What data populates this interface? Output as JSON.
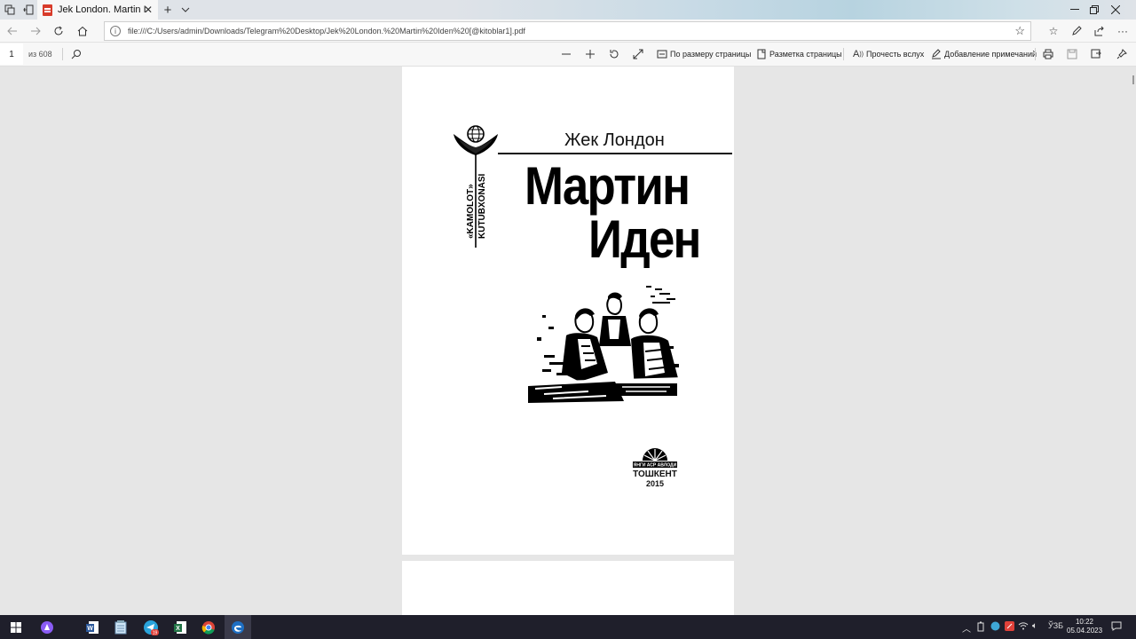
{
  "browser": {
    "tab_title": "Jek London. Martin Ider",
    "new_tab_label": "+",
    "address": "file:///C:/Users/admin/Downloads/Telegram%20Desktop/Jek%20London.%20Martin%20Iden%20[@kitoblar1].pdf"
  },
  "pdf_toolbar": {
    "page_number": "1",
    "page_count": "из 608",
    "fit_page_label": "По размеру страницы",
    "page_layout_label": "Разметка страницы",
    "read_aloud_label": "Прочесть вслух",
    "add_notes_label": "Добавление примечаний"
  },
  "document": {
    "series_top": "«KAMOLOT»",
    "series_bottom": "KUTUBXONASI",
    "author": "Жек Лондон",
    "title_line1": "Мартин",
    "title_line2": "Иден",
    "publisher_small": "ЯНГИ АСР АВЛОДИ",
    "city": "ТОШКЕНТ",
    "year": "2015"
  },
  "taskbar": {
    "telegram_badge": "19",
    "language": "ЎЗБ",
    "time": "10:22",
    "date": "05.04.2023"
  },
  "colors": {
    "pdf_red": "#d83b2a",
    "taskbar_bg": "#1f1f2b",
    "word_blue": "#2b579a",
    "excel_green": "#217346",
    "telegram_blue": "#2aa3db",
    "edge_blue": "#1e6fc4"
  }
}
